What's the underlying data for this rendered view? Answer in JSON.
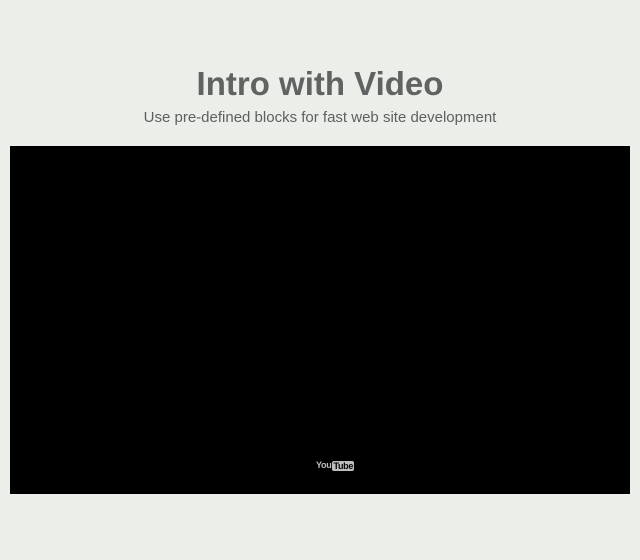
{
  "header": {
    "title": "Intro with Video",
    "subtitle": "Use pre-defined blocks for fast web site development"
  },
  "video": {
    "logo_part_1": "You",
    "logo_part_2": "Tube",
    "icon": "youtube-logo-icon",
    "background_color": "#000000"
  },
  "colors": {
    "page_background": "#eceeea",
    "title": "#616363",
    "subtitle": "#5d605f",
    "logo": "#bdbdbd"
  }
}
